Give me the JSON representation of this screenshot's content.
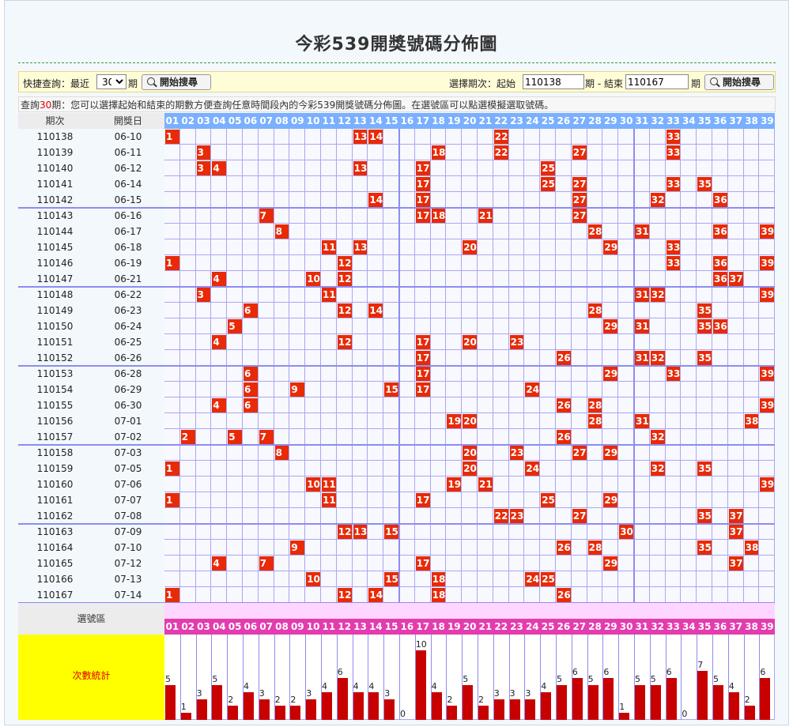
{
  "page": {
    "title": "今彩539開獎號碼分佈圖"
  },
  "quick": {
    "label": "快捷查詢：最近",
    "select_value": "30",
    "period_suffix": "期",
    "search_button": "開始搜尋",
    "range_label": "選擇期次：起始",
    "start_value": "110138",
    "mid_label": "期 - 結束",
    "end_value": "110167",
    "end_suffix": "期",
    "search_button2": "開始搜尋"
  },
  "info": {
    "prefix": "查詢",
    "count": "30",
    "suffix": "期：您可以選擇起始和結束的期數方便查詢任意時間段內的今彩539開獎號碼分佈圖。在選號區可以點選模擬選取號碼。"
  },
  "table": {
    "col_period": "期次",
    "col_date": "開獎日",
    "numbers": [
      "01",
      "02",
      "03",
      "04",
      "05",
      "06",
      "07",
      "08",
      "09",
      "10",
      "11",
      "12",
      "13",
      "14",
      "15",
      "16",
      "17",
      "18",
      "19",
      "20",
      "21",
      "22",
      "23",
      "24",
      "25",
      "26",
      "27",
      "28",
      "29",
      "30",
      "31",
      "32",
      "33",
      "34",
      "35",
      "36",
      "37",
      "38",
      "39"
    ],
    "rows": [
      {
        "period": "110138",
        "date": "06-10",
        "nums": [
          1,
          13,
          14,
          22,
          33
        ]
      },
      {
        "period": "110139",
        "date": "06-11",
        "nums": [
          3,
          18,
          22,
          27,
          33
        ]
      },
      {
        "period": "110140",
        "date": "06-12",
        "nums": [
          3,
          4,
          13,
          17,
          25
        ]
      },
      {
        "period": "110141",
        "date": "06-14",
        "nums": [
          17,
          25,
          27,
          33,
          35
        ]
      },
      {
        "period": "110142",
        "date": "06-15",
        "nums": [
          14,
          17,
          27,
          32,
          36
        ]
      },
      {
        "period": "110143",
        "date": "06-16",
        "nums": [
          7,
          17,
          18,
          21,
          27
        ]
      },
      {
        "period": "110144",
        "date": "06-17",
        "nums": [
          8,
          28,
          31,
          36,
          39
        ]
      },
      {
        "period": "110145",
        "date": "06-18",
        "nums": [
          11,
          13,
          20,
          29,
          33
        ]
      },
      {
        "period": "110146",
        "date": "06-19",
        "nums": [
          1,
          12,
          33,
          36,
          39
        ]
      },
      {
        "period": "110147",
        "date": "06-21",
        "nums": [
          4,
          10,
          12,
          36,
          37
        ]
      },
      {
        "period": "110148",
        "date": "06-22",
        "nums": [
          3,
          11,
          31,
          32,
          39
        ]
      },
      {
        "period": "110149",
        "date": "06-23",
        "nums": [
          6,
          12,
          14,
          28,
          35
        ]
      },
      {
        "period": "110150",
        "date": "06-24",
        "nums": [
          5,
          29,
          31,
          35,
          36
        ]
      },
      {
        "period": "110151",
        "date": "06-25",
        "nums": [
          4,
          12,
          17,
          20,
          23
        ]
      },
      {
        "period": "110152",
        "date": "06-26",
        "nums": [
          17,
          26,
          31,
          32,
          35
        ]
      },
      {
        "period": "110153",
        "date": "06-28",
        "nums": [
          6,
          17,
          29,
          33,
          39
        ]
      },
      {
        "period": "110154",
        "date": "06-29",
        "nums": [
          6,
          9,
          15,
          17,
          24
        ]
      },
      {
        "period": "110155",
        "date": "06-30",
        "nums": [
          4,
          6,
          26,
          28,
          39
        ]
      },
      {
        "period": "110156",
        "date": "07-01",
        "nums": [
          19,
          20,
          28,
          31,
          38
        ]
      },
      {
        "period": "110157",
        "date": "07-02",
        "nums": [
          2,
          5,
          7,
          26,
          32
        ]
      },
      {
        "period": "110158",
        "date": "07-03",
        "nums": [
          8,
          20,
          23,
          27,
          29
        ]
      },
      {
        "period": "110159",
        "date": "07-05",
        "nums": [
          1,
          20,
          24,
          32,
          35
        ]
      },
      {
        "period": "110160",
        "date": "07-06",
        "nums": [
          10,
          11,
          19,
          21,
          39
        ]
      },
      {
        "period": "110161",
        "date": "07-07",
        "nums": [
          1,
          11,
          17,
          25,
          29
        ]
      },
      {
        "period": "110162",
        "date": "07-08",
        "nums": [
          22,
          23,
          27,
          35,
          37
        ]
      },
      {
        "period": "110163",
        "date": "07-09",
        "nums": [
          12,
          13,
          15,
          30,
          37
        ]
      },
      {
        "period": "110164",
        "date": "07-10",
        "nums": [
          9,
          26,
          28,
          35,
          38
        ]
      },
      {
        "period": "110165",
        "date": "07-12",
        "nums": [
          4,
          7,
          17,
          29,
          37
        ]
      },
      {
        "period": "110166",
        "date": "07-13",
        "nums": [
          10,
          15,
          18,
          24,
          25
        ]
      },
      {
        "period": "110167",
        "date": "07-14",
        "nums": [
          1,
          12,
          14,
          18,
          26
        ]
      }
    ],
    "select_label": "選號區",
    "stats_label": "次數統計",
    "counts": [
      5,
      1,
      3,
      5,
      2,
      4,
      3,
      2,
      2,
      3,
      4,
      6,
      4,
      4,
      3,
      0,
      10,
      4,
      2,
      5,
      2,
      3,
      3,
      3,
      4,
      5,
      6,
      5,
      6,
      1,
      5,
      5,
      6,
      0,
      7,
      5,
      4,
      2,
      6
    ],
    "count_labels": [
      "5",
      "1",
      "3",
      "5",
      "2",
      "4",
      "3",
      "2",
      "2",
      "3",
      "4",
      "6",
      "4",
      "4",
      "3",
      "0",
      "10",
      "4",
      "2",
      "5",
      "2",
      "3",
      "3",
      "3",
      "4",
      "5",
      "6",
      "5",
      "6",
      "1",
      "5",
      "5",
      "6",
      "0",
      "7",
      "5",
      "4",
      "2",
      "6"
    ]
  },
  "colors": {
    "hit": "#e82a06",
    "header": "#7ab0ff",
    "select": "#e33cae",
    "bar": "#c80000",
    "stats_bg": "#ffff00"
  }
}
